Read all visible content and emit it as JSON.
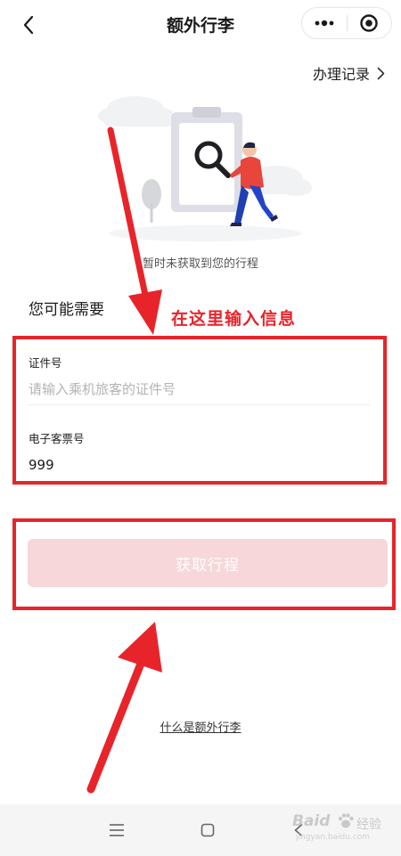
{
  "nav": {
    "title": "额外行李",
    "back_icon": "chevron-left-icon",
    "more_icon": "more-dots-icon",
    "close_icon": "target-close-icon"
  },
  "records_link": {
    "label": "办理记录",
    "icon": "chevron-right-icon"
  },
  "empty_state": {
    "message": "暂时未获取到您的行程",
    "illustration": "clipboard-magnifier-person-illustration"
  },
  "section": {
    "title": "您可能需要"
  },
  "annotation": {
    "text": "在这里输入信息",
    "color": "#e8242b"
  },
  "form": {
    "id_field": {
      "label": "证件号",
      "value": "",
      "placeholder": "请输入乘机旅客的证件号"
    },
    "ticket_field": {
      "label": "电子客票号",
      "value": "999",
      "placeholder": ""
    }
  },
  "fetch_button": {
    "label": "获取行程",
    "color": "#f7d7d9"
  },
  "help_link": {
    "label": "什么是额外行李"
  },
  "system_nav": {
    "menu_icon": "menu-lines-icon",
    "home_icon": "square-home-icon",
    "back_icon": "back-triangle-icon"
  },
  "watermark": {
    "brand": "Baid",
    "brand_suffix": "经验",
    "url": "jingyan.baidu.com"
  }
}
